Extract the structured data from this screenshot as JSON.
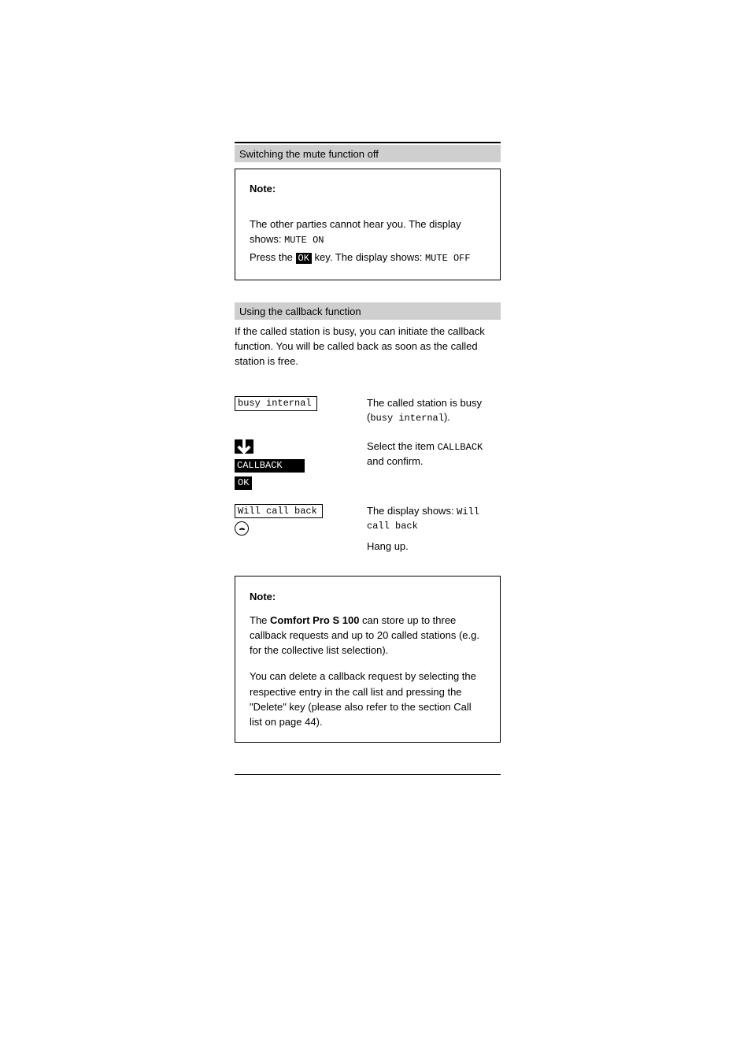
{
  "section1": {
    "title": "Switching the mute function off",
    "note_label": "Note:",
    "note_body": "The other parties cannot hear you. The display shows: ",
    "mute_on": "MUTE ON",
    "instruction_prefix": "Press the ",
    "instruction_suffix": " key. The display shows: ",
    "ok": "OK",
    "mute_off": "MUTE OFF"
  },
  "section2": {
    "title": "Using the callback function",
    "intro": "If the called station is busy, you can initiate the callback function. You will be called back as soon as the called station is free.",
    "step1": {
      "display": "busy internal",
      "text_prefix": "The called station is busy (",
      "text_value": "busy internal",
      "text_suffix": ")."
    },
    "step2": {
      "display": "CALLBACK",
      "ok": "OK",
      "text_prefix": "Select the item ",
      "text_value": "CALLBACK",
      "text_suffix": " and confirm."
    },
    "step3": {
      "display": "Will call back",
      "text_prefix": "The display shows: ",
      "text_value": "Will call back",
      "hangup": "Hang up."
    }
  },
  "notebox": {
    "label": "Note:",
    "para1_pre": "The ",
    "para1_bold": "Comfort Pro S 100",
    "para1_post": " can store up to three callback requests and up to 20 called stations (e.g. for the collective list selection).",
    "para2": "You can delete a callback request by selecting the respective entry in the call list and pressing the \"Delete\" key (please also refer to the section Call list  on page 44)."
  }
}
